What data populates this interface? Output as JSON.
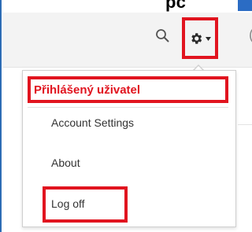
{
  "header": {
    "cropped_word": "pc",
    "edge_glyph": "("
  },
  "toolbar": {
    "search_icon": "search-icon",
    "settings_icon": "gear-icon",
    "settings_caret_icon": "chevron-down-icon"
  },
  "dropdown": {
    "signed_in_user": "Přihlášený uživatel",
    "items": [
      {
        "label": "Account Settings"
      },
      {
        "label": "About"
      },
      {
        "label": "Log off"
      }
    ]
  },
  "colors": {
    "highlight": "#e1141f",
    "accent_blue": "#2b6cc4",
    "toolbar_bg": "#f3f3f3",
    "menu_text": "#333333"
  }
}
